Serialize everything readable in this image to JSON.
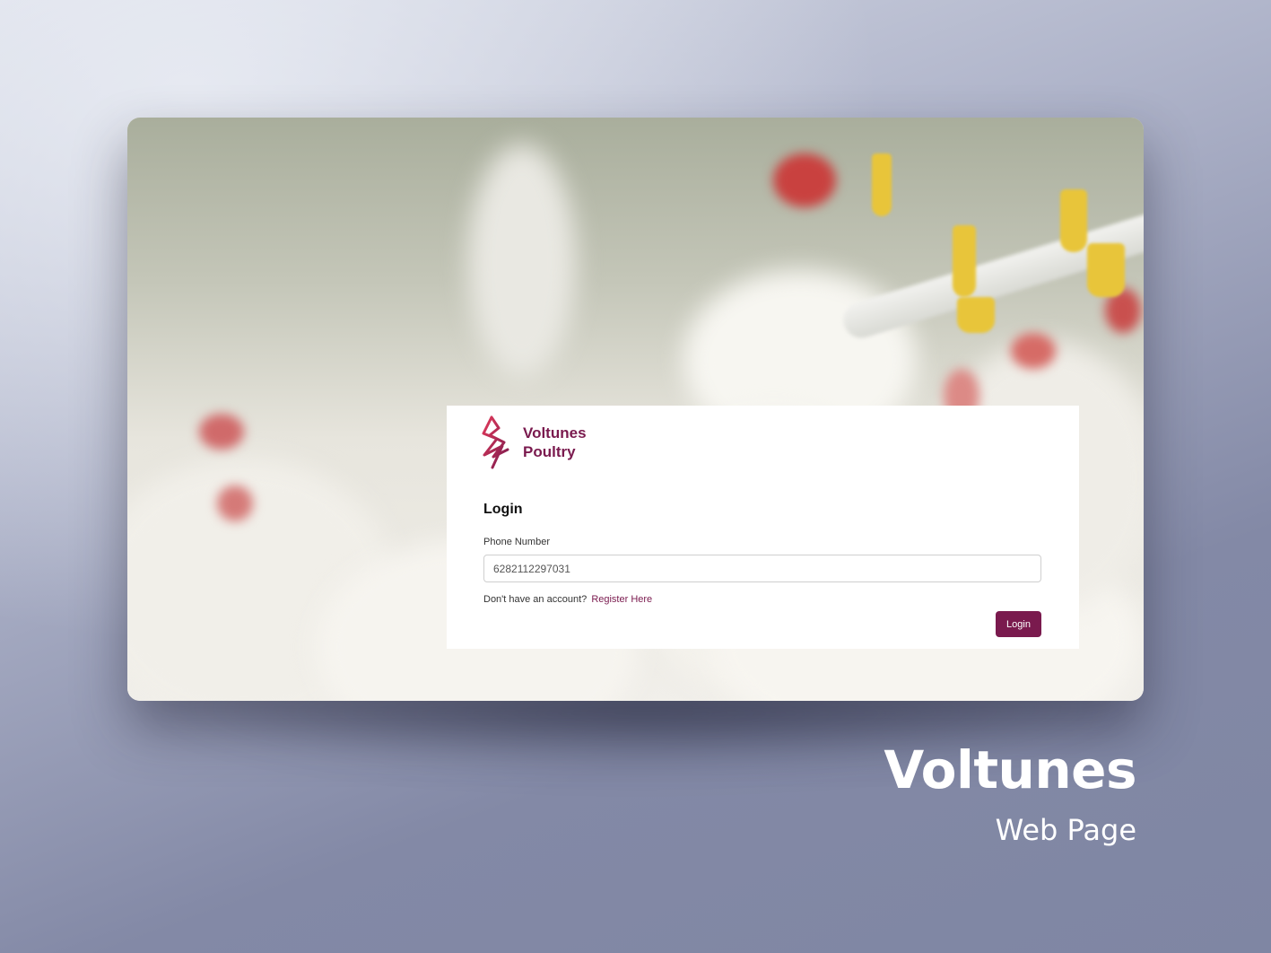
{
  "brand": {
    "name_line1": "Voltunes",
    "name_line2": "Poultry",
    "color": "#7a1a4e",
    "logo_icon": "lightning-bolt-icon"
  },
  "login": {
    "title": "Login",
    "phone_label": "Phone Number",
    "phone_value": "6282112297031",
    "register_prompt": "Don't have an account?",
    "register_link": "Register Here",
    "submit_label": "Login"
  },
  "caption": {
    "title": "Voltunes",
    "subtitle": "Web Page"
  },
  "colors": {
    "accent": "#7a1a4e",
    "background_dark": "#7f86a3",
    "background_light": "#d9dde8"
  }
}
